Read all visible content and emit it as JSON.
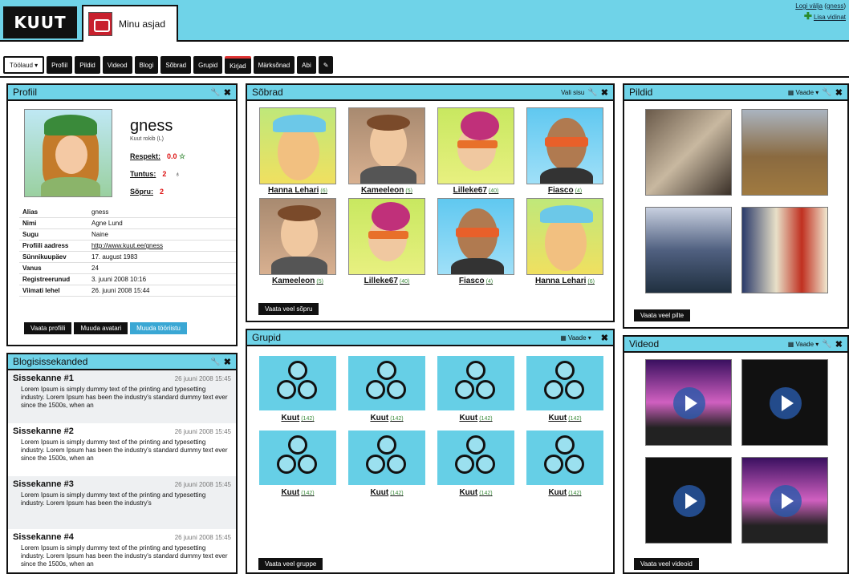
{
  "header": {
    "logo": "KUUT",
    "tab_label": "Minu asjad",
    "logout": "Logi välja",
    "username": "gness",
    "add_widget": "Lisa vidinat"
  },
  "nav": [
    "Töölaud",
    "Profiil",
    "Pildid",
    "Videod",
    "Blogi",
    "Sõbrad",
    "Grupid",
    "Kirjad",
    "Märksõnad",
    "Abi"
  ],
  "profile": {
    "title": "Profiil",
    "name": "gness",
    "subtitle": "Kuut rokib (L)",
    "respekt_label": "Respekt:",
    "respekt_value": "0.0",
    "tuntus_label": "Tuntus:",
    "tuntus_value": "2",
    "sobru_label": "Sõpru:",
    "sobru_value": "2",
    "info": [
      {
        "k": "Alias",
        "v": "gness"
      },
      {
        "k": "Nimi",
        "v": "Agne Lund"
      },
      {
        "k": "Sugu",
        "v": "Naine"
      },
      {
        "k": "Profiili aadress",
        "v": "http://www.kuut.ee/gness"
      },
      {
        "k": "Sünnikuupäev",
        "v": "17. august 1983"
      },
      {
        "k": "Vanus",
        "v": "24"
      },
      {
        "k": "Registreerunud",
        "v": "3. juuni 2008 10:16"
      },
      {
        "k": "Viimati lehel",
        "v": "26. juuni 2008 15:44"
      }
    ],
    "btn_view": "Vaata profiili",
    "btn_avatar": "Muuda avatari",
    "btn_settings": "Muuda tööriistu"
  },
  "blog": {
    "title": "Blogisissekanded",
    "entries": [
      {
        "title": "Sissekanne #1",
        "date": "26 juuni 2008 15:45",
        "text": "Lorem Ipsum is simply dummy text of the printing and typesetting industry. Lorem Ipsum has been the industry's standard dummy text ever since the 1500s, when an"
      },
      {
        "title": "Sissekanne #2",
        "date": "26 juuni 2008 15:45",
        "text": "Lorem Ipsum is simply dummy text of the printing and typesetting industry. Lorem Ipsum has been the industry's standard dummy text ever since the 1500s, when an"
      },
      {
        "title": "Sissekanne #3",
        "date": "26 juuni 2008 15:45",
        "text": "Lorem Ipsum is simply dummy text of the printing and typesetting industry. Lorem Ipsum has been the industry's"
      },
      {
        "title": "Sissekanne #4",
        "date": "26 juuni 2008 15:45",
        "text": "Lorem Ipsum is simply dummy text of the printing and typesetting industry. Lorem Ipsum has been the industry's standard dummy text ever since the 1500s, when an"
      }
    ]
  },
  "friends": {
    "title": "Sõbrad",
    "ctrl": "Vali sisu",
    "more": "Vaata veel sõpru",
    "items": [
      {
        "name": "Hanna Lehari",
        "count": "(6)"
      },
      {
        "name": "Kameeleon",
        "count": "(5)"
      },
      {
        "name": "Lilleke67",
        "count": "(40)"
      },
      {
        "name": "Fiasco",
        "count": "(4)"
      },
      {
        "name": "Kameeleon",
        "count": "(5)"
      },
      {
        "name": "Lilleke67",
        "count": "(40)"
      },
      {
        "name": "Fiasco",
        "count": "(4)"
      },
      {
        "name": "Hanna Lehari",
        "count": "(6)"
      }
    ]
  },
  "groups": {
    "title": "Grupid",
    "ctrl": "Vaade",
    "more": "Vaata veel gruppe",
    "items": [
      {
        "name": "Kuut",
        "count": "(142)"
      },
      {
        "name": "Kuut",
        "count": "(142)"
      },
      {
        "name": "Kuut",
        "count": "(142)"
      },
      {
        "name": "Kuut",
        "count": "(142)"
      },
      {
        "name": "Kuut",
        "count": "(142)"
      },
      {
        "name": "Kuut",
        "count": "(142)"
      },
      {
        "name": "Kuut",
        "count": "(142)"
      },
      {
        "name": "Kuut",
        "count": "(142)"
      }
    ]
  },
  "pictures": {
    "title": "Pildid",
    "ctrl": "Vaade",
    "more": "Vaata veel pilte"
  },
  "videos": {
    "title": "Videod",
    "ctrl": "Vaade",
    "more": "Vaata veel videoid"
  }
}
